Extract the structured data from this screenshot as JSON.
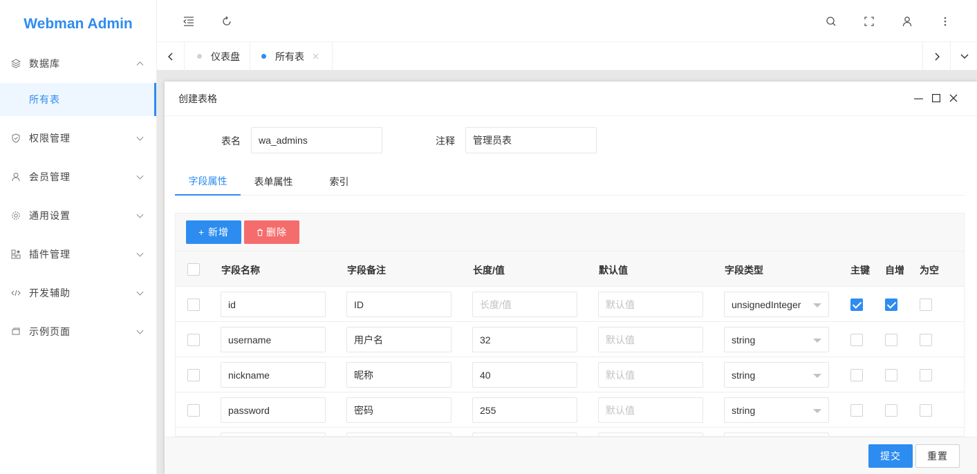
{
  "app": {
    "title": "Webman Admin"
  },
  "sidebar": {
    "items": [
      {
        "label": "数据库",
        "icon": "layers-icon",
        "expanded": true
      },
      {
        "label": "所有表",
        "active": true
      },
      {
        "label": "权限管理",
        "icon": "shield-icon"
      },
      {
        "label": "会员管理",
        "icon": "user-icon"
      },
      {
        "label": "通用设置",
        "icon": "gear-icon"
      },
      {
        "label": "插件管理",
        "icon": "apps-icon"
      },
      {
        "label": "开发辅助",
        "icon": "code-icon"
      },
      {
        "label": "示例页面",
        "icon": "page-icon"
      }
    ]
  },
  "tabs": [
    {
      "label": "仪表盘",
      "active": false
    },
    {
      "label": "所有表",
      "active": true
    }
  ],
  "dialog": {
    "title": "创建表格",
    "table_name_label": "表名",
    "table_name_value": "wa_admins",
    "comment_label": "注释",
    "comment_value": "管理员表",
    "tabs": [
      "字段属性",
      "表单属性",
      "索引"
    ],
    "add_label": "+ 新增",
    "delete_label": "删除",
    "columns": [
      "字段名称",
      "字段备注",
      "长度/值",
      "默认值",
      "字段类型",
      "主键",
      "自增",
      "为空"
    ],
    "placeholders": {
      "length": "长度/值",
      "default": "默认值"
    },
    "rows": [
      {
        "name": "id",
        "comment": "ID",
        "length": "",
        "default": "",
        "type": "unsignedInteger",
        "primary": true,
        "auto": true,
        "nullable": false
      },
      {
        "name": "username",
        "comment": "用户名",
        "length": "32",
        "default": "",
        "type": "string",
        "primary": false,
        "auto": false,
        "nullable": false
      },
      {
        "name": "nickname",
        "comment": "昵称",
        "length": "40",
        "default": "",
        "type": "string",
        "primary": false,
        "auto": false,
        "nullable": false
      },
      {
        "name": "password",
        "comment": "密码",
        "length": "255",
        "default": "",
        "type": "string",
        "primary": false,
        "auto": false,
        "nullable": false
      }
    ],
    "submit_label": "提交",
    "reset_label": "重置"
  },
  "colors": {
    "accent": "#2d8cf0",
    "danger": "#f56c6c"
  }
}
